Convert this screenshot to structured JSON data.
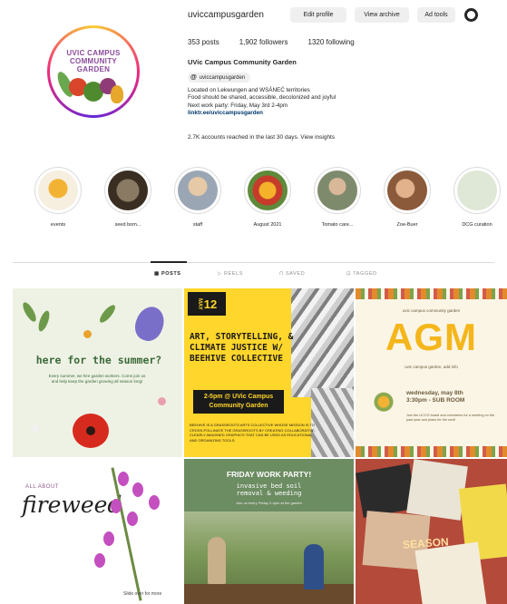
{
  "profile": {
    "username": "uviccampusgarden",
    "buttons": {
      "edit": "Edit profile",
      "archive": "View archive",
      "adtools": "Ad tools"
    },
    "stats": {
      "posts": "353 posts",
      "followers": "1,902 followers",
      "following": "1320 following"
    },
    "full_name": "UVic Campus Community Garden",
    "threads_handle": "uviccampusgarden",
    "bio": [
      "Located on Lekwungen and WSÁNEĆ territories",
      "Food should be shared, accessible, decolonized and joyful",
      "Next work party: Friday, May 3rd 2-4pm",
      "linktr.ee/uviccampusgarden"
    ],
    "insights": "2.7K accounts reached in the last 30 days. View insights",
    "avatar_text": [
      "UVIC CAMPUS",
      "COMMUNITY",
      "GARDEN"
    ]
  },
  "highlights": [
    {
      "label": "events",
      "color": "#f6efe0"
    },
    {
      "label": "seed bom...",
      "color": "#5a4a3a"
    },
    {
      "label": "staff",
      "color": "#c9b49a"
    },
    {
      "label": "August 2021",
      "color": "#c63b2a"
    },
    {
      "label": "Tomato care...",
      "color": "#7e8a6c"
    },
    {
      "label": "Zoe-Buer",
      "color": "#a5744f"
    },
    {
      "label": "DCG curation",
      "color": "#dfe7d6"
    }
  ],
  "tabs": [
    "POSTS",
    "REELS",
    "SAVED",
    "TAGGED"
  ],
  "posts": {
    "p1": {
      "heading": "here for the summer?",
      "body": "Every summer, we hire garden workers. Come join us and help keep the garden growing all season long!"
    },
    "p2": {
      "badge": "12",
      "title": "ART, STORYTELLING, & CLIMATE JUSTICE W/ BEEHIVE COLLECTIVE",
      "time": "2-5pm @ UVic Campus Community Garden",
      "fine": "BEEHIVE IS A GRASSROOTS ARTS COLLECTIVE WHOSE MISSION IS TO CROSS-POLLINATE THE GRASSROOTS BY CREATING COLLABORATIVE, CLEARLY-IMAGINED GRAPHICS THAT CAN BE USED AS EDUCATIONAL AND ORGANIZING TOOLS."
    },
    "p3": {
      "top": "uvic campus community garden",
      "agm": "AGM",
      "sub": "uvic campus garden, add info",
      "date": "wednesday, may 8th\n3:30pm - SUB ROOM",
      "note": "Join the UCCG board and volunteers for a meeting on the past year and plans for the next!"
    },
    "p4": {
      "all_about": "ALL ABOUT",
      "title": "fireweed",
      "caption": "Slide over for more"
    },
    "p5": {
      "heading": "FRIDAY WORK PARTY!",
      "sub": "invasive bed soil\nremoval & weeding",
      "fine": "Join us every Friday 2-4pm at the garden"
    },
    "p6": {
      "word": "SEASON"
    }
  }
}
